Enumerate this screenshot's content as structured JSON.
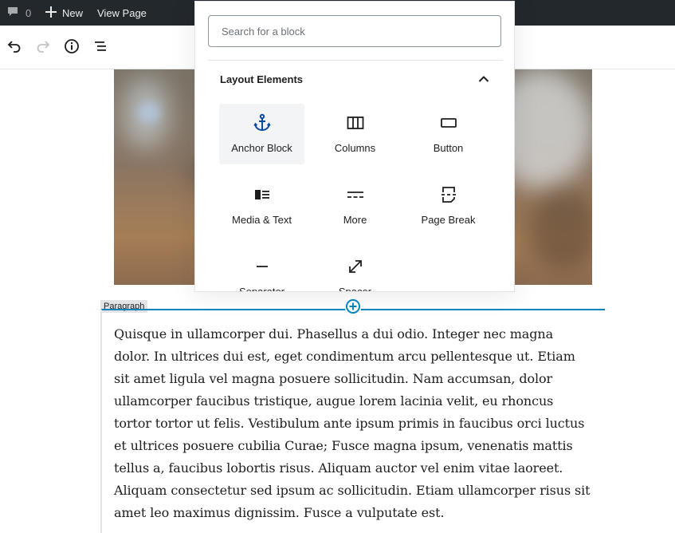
{
  "admin_bar": {
    "comments_count": "0",
    "new_label": "New",
    "view_page_label": "View Page"
  },
  "toolbar": {
    "icons": [
      "undo-icon",
      "redo-icon",
      "info-icon",
      "block-navigation-icon"
    ]
  },
  "inserter": {
    "search_placeholder": "Search for a block",
    "panel_title": "Layout Elements",
    "blocks": [
      {
        "label": "Anchor Block",
        "icon": "anchor-icon"
      },
      {
        "label": "Columns",
        "icon": "columns-icon"
      },
      {
        "label": "Button",
        "icon": "button-icon"
      },
      {
        "label": "Media & Text",
        "icon": "media-text-icon"
      },
      {
        "label": "More",
        "icon": "more-icon"
      },
      {
        "label": "Page Break",
        "icon": "page-break-icon"
      },
      {
        "label": "Separator",
        "icon": "separator-icon"
      },
      {
        "label": "Spacer",
        "icon": "spacer-icon"
      }
    ]
  },
  "paragraph": {
    "label": "Paragraph",
    "text": "Quisque in ullamcorper dui. Phasellus a dui odio. Integer nec magna dolor. In ultrices dui est, eget condimentum arcu pellentesque ut. Etiam sit amet ligula vel magna posuere sollicitudin. Nam accumsan, dolor ullamcorper faucibus tristique, augue lorem lacinia velit, eu rhoncus tortor tortor ut felis. Vestibulum ante ipsum primis in faucibus orci luctus et ultrices posuere cubilia Curae; Fusce magna ipsum, venenatis mattis tellus a, faucibus lobortis risus. Aliquam auctor vel enim vitae laoreet. Aliquam consectetur sed ipsum ac sollicitudin. Etiam ullamcorper risus sit amet leo maximus dignissim. Fusce a vulputate est."
  },
  "colors": {
    "admin_bar_bg": "#23282d",
    "accent": "#0085ba",
    "anchor_icon": "#0a4b9c"
  }
}
